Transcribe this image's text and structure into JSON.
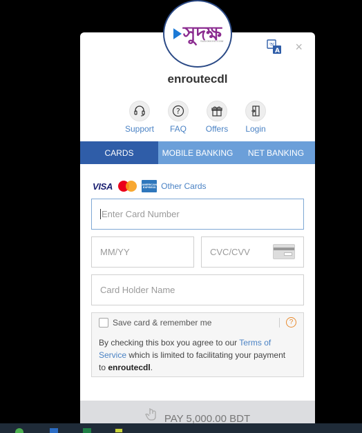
{
  "merchant": {
    "name": "enroutecdl"
  },
  "logo": {
    "text": "সুদক্ষ",
    "subtext": "SUDOKKHO.COM"
  },
  "header": {
    "close_symbol": "×"
  },
  "quick_links": [
    {
      "label": "Support",
      "icon": "headset-icon"
    },
    {
      "label": "FAQ",
      "icon": "question-icon"
    },
    {
      "label": "Offers",
      "icon": "gift-icon"
    },
    {
      "label": "Login",
      "icon": "login-icon"
    }
  ],
  "tabs": [
    {
      "label": "CARDS",
      "active": true
    },
    {
      "label": "MOBILE BANKING",
      "active": false
    },
    {
      "label": "NET BANKING",
      "active": false
    }
  ],
  "card_brands": {
    "visa": "VISA",
    "amex": "AMERICAN EXPRESS",
    "other": "Other Cards"
  },
  "form": {
    "card_number_placeholder": "Enter Card Number",
    "expiry_placeholder": "MM/YY",
    "cvc_placeholder": "CVC/CVV",
    "holder_placeholder": "Card Holder Name"
  },
  "save_card": {
    "label": "Save card & remember me",
    "help_symbol": "?",
    "terms_prefix": "By checking this box you agree to our ",
    "terms_link": "Terms of Service",
    "terms_middle": " which is limited to facilitating your payment to ",
    "terms_merchant": "enroutecdl",
    "terms_suffix": "."
  },
  "pay": {
    "label": "PAY 5,000.00 BDT"
  },
  "colors": {
    "tab_bg": "#6b9fd9",
    "tab_active": "#2f5da8",
    "link": "#4a82c4",
    "help": "#e88a2e"
  }
}
